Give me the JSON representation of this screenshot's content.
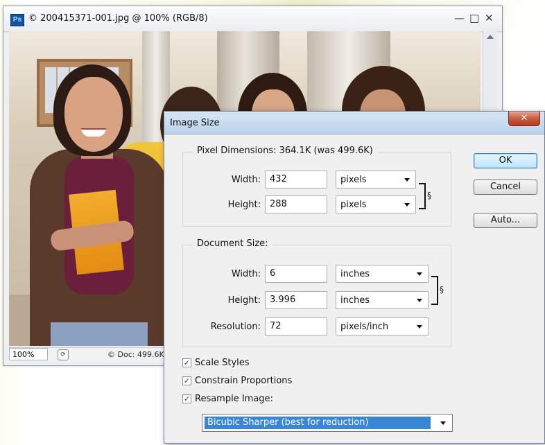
{
  "document_window": {
    "app_icon_label": "Ps",
    "title": "© 200415371-001.jpg @ 100% (RGB/8)",
    "minimize_symbol": "—",
    "maximize_symbol": "□",
    "close_symbol": "✕",
    "zoom_level": "100%",
    "status_text": "© Doc: 499.6K"
  },
  "dialog": {
    "title": "Image Size",
    "close_symbol": "✕",
    "pixel_dimensions": {
      "title": "Pixel Dimensions:  364.1K (was 499.6K)",
      "width_label": "Width:",
      "width_value": "432",
      "width_unit": "pixels",
      "height_label": "Height:",
      "height_value": "288",
      "height_unit": "pixels",
      "link_icon": "chain-link-icon"
    },
    "document_size": {
      "title": "Document Size:",
      "width_label": "Width:",
      "width_value": "6",
      "width_unit": "inches",
      "height_label": "Height:",
      "height_value": "3.996",
      "height_unit": "inches",
      "resolution_label": "Resolution:",
      "resolution_value": "72",
      "resolution_unit": "pixels/inch",
      "link_icon": "chain-link-icon"
    },
    "buttons": {
      "ok": "OK",
      "cancel": "Cancel",
      "auto": "Auto..."
    },
    "options": {
      "scale_styles": {
        "label": "Scale Styles",
        "checked": true
      },
      "constrain_proportions": {
        "label": "Constrain Proportions",
        "checked": true
      },
      "resample_image": {
        "label": "Resample Image:",
        "checked": true
      }
    },
    "resample_method": "Bicubic Sharper (best for reduction)",
    "check_mark": "✓"
  },
  "colors": {
    "dialog_bg": "#f0f0f0",
    "title_bar_blue": "#abcae8",
    "selection_blue": "#3a86d6",
    "ok_button_border": "#3c7fb1",
    "close_button_red": "#c75a3f",
    "ps_icon_blue": "#0f55a4"
  }
}
